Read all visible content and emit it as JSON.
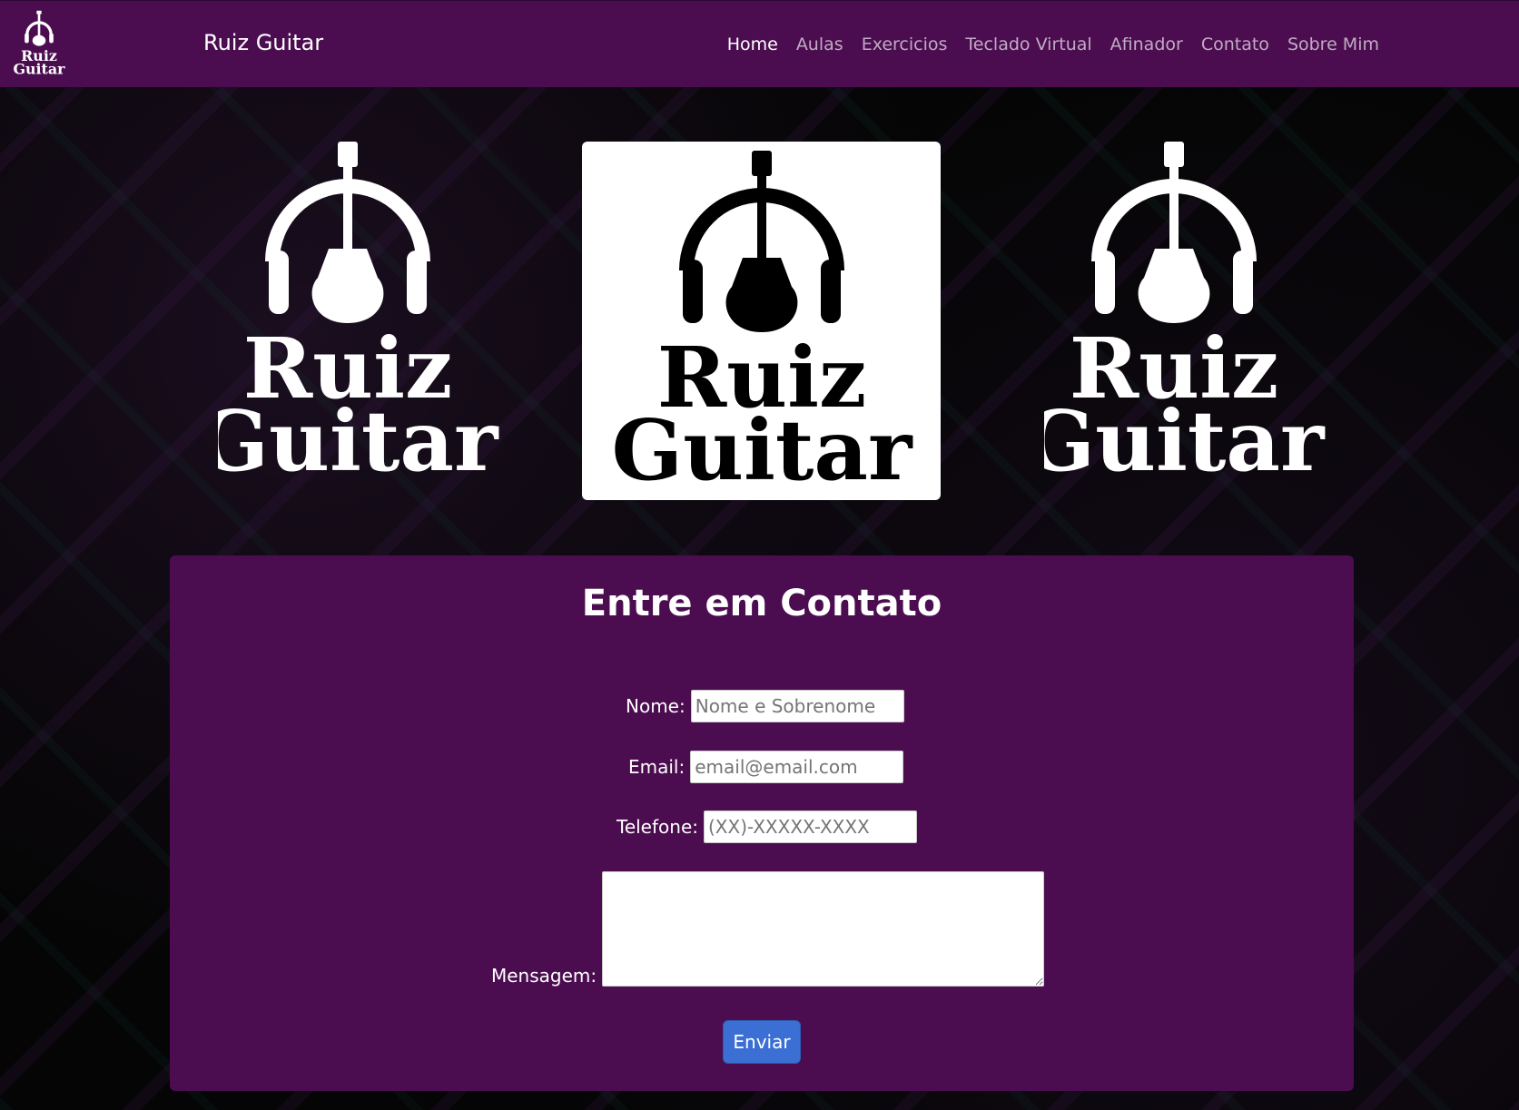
{
  "navbar": {
    "logo_text_top": "Ruiz",
    "logo_text_bottom": "Guitar",
    "brand": "Ruiz Guitar",
    "links": [
      {
        "label": "Home",
        "active": true
      },
      {
        "label": "Aulas",
        "active": false
      },
      {
        "label": "Exercicios",
        "active": false
      },
      {
        "label": "Teclado Virtual",
        "active": false
      },
      {
        "label": "Afinador",
        "active": false
      },
      {
        "label": "Contato",
        "active": false
      },
      {
        "label": "Sobre Mim",
        "active": false
      }
    ]
  },
  "hero": {
    "logo_line1": "Ruiz",
    "logo_line2": "Guitar"
  },
  "contact": {
    "title": "Entre em Contato",
    "fields": {
      "nome": {
        "label": "Nome:",
        "placeholder": "Nome e Sobrenome",
        "value": ""
      },
      "email": {
        "label": "Email:",
        "placeholder": "email@email.com",
        "value": ""
      },
      "telefone": {
        "label": "Telefone:",
        "placeholder": "(XX)-XXXXX-XXXX",
        "value": ""
      },
      "mensagem": {
        "label": "Mensagem:",
        "value": ""
      }
    },
    "submit_label": "Enviar"
  },
  "colors": {
    "primary_purple": "#4b0d50",
    "button_blue": "#3b6fd4",
    "background": "#050505"
  },
  "icons": {
    "logo": "guitar-headphones-logo-icon"
  }
}
